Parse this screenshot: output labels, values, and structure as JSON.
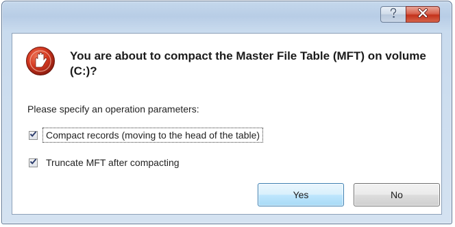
{
  "titlebar": {
    "help_icon": "question-mark-icon",
    "close_icon": "close-x-icon"
  },
  "dialog": {
    "app_icon": "hand-on-red-circle-icon",
    "heading": "You are about to compact the Master File Table (MFT) on volume (C:)?",
    "prompt": "Please specify an operation parameters:",
    "options": [
      {
        "label": "Compact records (moving to the head of the table)",
        "checked": true
      },
      {
        "label": "Truncate MFT after compacting",
        "checked": true
      }
    ],
    "yes_label": "Yes",
    "no_label": "No"
  },
  "colors": {
    "titlebar": "#b8cde6",
    "close_button": "#c4321b",
    "default_button_border": "#3c7fb1"
  }
}
